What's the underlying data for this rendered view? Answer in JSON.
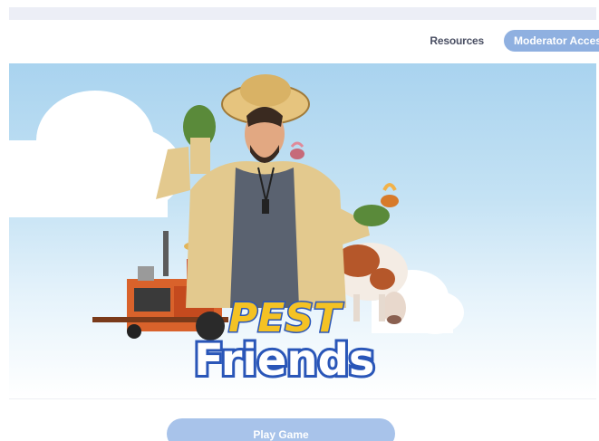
{
  "header": {
    "nav_resources": "Resources",
    "nav_moderator": "Moderator Access"
  },
  "hero": {
    "logo_line1": "PEST",
    "logo_line2": "Friends"
  },
  "actions": {
    "play_label": "Play Game"
  },
  "colors": {
    "accent": "#8fb0e0",
    "play_button": "#a8c3ea",
    "logo_yellow": "#f4c224",
    "logo_blue": "#2a56b8"
  }
}
